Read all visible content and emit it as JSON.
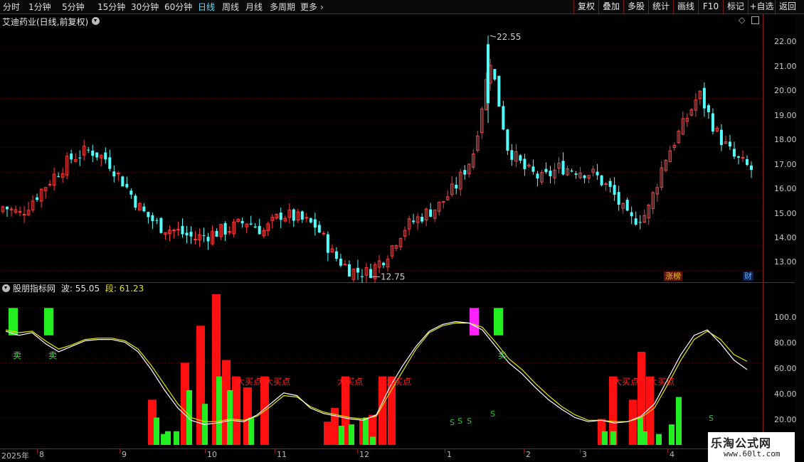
{
  "toolbar": {
    "periods": [
      "分时",
      "1分钟",
      "5分钟",
      "15分钟",
      "30分钟",
      "60分钟",
      "日线",
      "周线",
      "月线",
      "多周期",
      "更多"
    ],
    "active_period": "日线",
    "buttons": [
      "复权",
      "叠加",
      "多股",
      "统计",
      "画线",
      "F10",
      "标记",
      "+自选",
      "返回"
    ]
  },
  "main_pane": {
    "title": "艾迪药业(日线,前复权)",
    "high_label": "22.55",
    "low_label": "12.75",
    "price_axis": [
      "22.00",
      "21.00",
      "20.00",
      "19.00",
      "18.00",
      "17.00",
      "16.00",
      "15.00",
      "14.00",
      "13.00"
    ],
    "badge_left": "涨榜",
    "badge_right": "财"
  },
  "indicator": {
    "name": "股朋指标网",
    "wave_label": "波:",
    "wave_value": "55.05",
    "seg_label": "段:",
    "seg_value": "61.23",
    "axis": [
      "100.0",
      "80.00",
      "60.00",
      "40.00",
      "20.00"
    ],
    "sell_label": "卖",
    "buy_label": "大买点",
    "s_label": "S"
  },
  "date_axis": {
    "labels": [
      "2025年",
      "8",
      "9",
      "10",
      "11",
      "12",
      "1",
      "2",
      "3",
      "4"
    ]
  },
  "watermark": {
    "title": "乐淘公式网",
    "url": "www.60lt.com"
  },
  "colors": {
    "up": "#ff3b3b",
    "down": "#54ffff",
    "grid": "#5a0000",
    "wave_line": "#ffffff",
    "seg_line": "#e6e600",
    "green_bar": "#22ee22",
    "red_bar": "#ff1010",
    "magenta_bar": "#ff22ff"
  },
  "chart_data": [
    {
      "type": "candlestick",
      "title": "艾迪药业(日线,前复权)",
      "ylim": [
        12.5,
        22.9
      ],
      "x_categories": [
        "8",
        "9",
        "10",
        "11",
        "12",
        "1",
        "2",
        "3",
        "4"
      ],
      "close_trend": [
        15.6,
        15.3,
        16.1,
        16.9,
        17.6,
        17.9,
        17.5,
        16.5,
        15.4,
        14.8,
        14.6,
        14.3,
        14.5,
        14.7,
        15.0,
        14.6,
        15.3,
        15.1,
        14.8,
        13.6,
        13.0,
        12.9,
        13.6,
        14.7,
        15.2,
        15.6,
        16.4,
        17.7,
        21.6,
        18.0,
        17.1,
        16.7,
        17.2,
        17.1,
        16.9,
        16.2,
        15.0,
        15.3,
        17.5,
        18.8,
        20.2,
        18.6,
        17.6,
        17.1
      ],
      "high": 22.55,
      "low": 12.75
    },
    {
      "type": "bar",
      "title": "股朋指标网",
      "ylim": [
        0,
        110
      ],
      "series": [
        {
          "name": "波",
          "last": 55.05
        },
        {
          "name": "段",
          "last": 61.23
        }
      ],
      "wave": [
        83,
        80,
        82,
        74,
        68,
        72,
        76,
        77,
        77,
        75,
        68,
        55,
        40,
        27,
        18,
        15,
        16,
        18,
        17,
        22,
        30,
        38,
        36,
        27,
        23,
        21,
        19,
        18,
        22,
        42,
        58,
        72,
        83,
        88,
        90,
        89,
        84,
        72,
        60,
        52,
        42,
        33,
        26,
        20,
        17,
        18,
        16,
        17,
        21,
        30,
        48,
        66,
        80,
        84,
        74,
        62,
        55
      ],
      "seg": [
        84,
        82,
        83,
        76,
        70,
        73,
        77,
        78,
        78,
        76,
        70,
        58,
        44,
        30,
        20,
        17,
        17,
        19,
        18,
        21,
        28,
        36,
        35,
        28,
        24,
        22,
        20,
        19,
        21,
        38,
        54,
        70,
        82,
        87,
        89,
        89,
        86,
        75,
        63,
        55,
        45,
        36,
        28,
        22,
        18,
        18,
        17,
        17,
        20,
        27,
        44,
        62,
        77,
        83,
        77,
        66,
        61
      ],
      "red_bars": [
        33,
        60,
        87,
        118,
        62,
        50,
        42,
        50,
        17,
        27,
        50,
        18,
        22,
        50,
        50,
        19,
        50,
        33,
        68,
        50
      ],
      "green_bars": [
        20,
        40,
        30,
        50,
        40,
        20,
        10,
        14,
        15,
        6,
        20,
        10,
        10,
        10,
        20,
        8,
        15,
        35,
        10,
        8
      ],
      "annotations": [
        "卖",
        "卖",
        "卖",
        "大买点",
        "大买点",
        "大买点",
        "大买点",
        "S",
        "S",
        "S",
        "S",
        "S"
      ]
    }
  ]
}
